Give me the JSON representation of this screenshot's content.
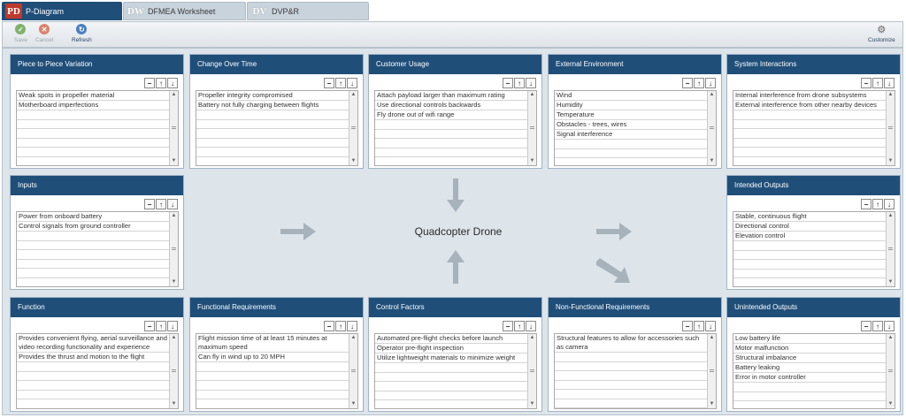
{
  "tabs": [
    {
      "abbr": "PD",
      "label": "P-Diagram"
    },
    {
      "abbr": "DW",
      "label": "DFMEA Worksheet"
    },
    {
      "abbr": "DV",
      "label": "DVP&R"
    }
  ],
  "toolbar": {
    "save": "Save",
    "cancel": "Cancel",
    "refresh": "Refresh",
    "customize": "Customize"
  },
  "center": {
    "title": "Quadcopter Drone"
  },
  "panel_buttons": {
    "remove": "−",
    "up": "↑",
    "down": "↓"
  },
  "panels": {
    "piece": {
      "title": "Piece to Piece Variation",
      "items": [
        "Weak spots in propeller material",
        "Motherboard imperfections"
      ]
    },
    "change": {
      "title": "Change Over Time",
      "items": [
        "Propeller integrity compromised",
        "Battery not fully charging between flights"
      ]
    },
    "customer": {
      "title": "Customer Usage",
      "items": [
        "Attach payload larger than maximum rating",
        "Use directional controls backwards",
        "Fly drone out of wifi range"
      ]
    },
    "external": {
      "title": "External Environment",
      "items": [
        "Wind",
        "Humidity",
        "Temperature",
        "Obstacles - trees, wires",
        "Signal interference"
      ]
    },
    "system": {
      "title": "System Interactions",
      "items": [
        "Internal interference from drone subsystems",
        "External interference from other nearby devices"
      ]
    },
    "inputs": {
      "title": "Inputs",
      "items": [
        "Power from onboard battery",
        "Control signals from ground controller"
      ]
    },
    "intended": {
      "title": "Intended Outputs",
      "items": [
        "Stable, continuous flight",
        "Directional control",
        "Elevation control"
      ]
    },
    "function": {
      "title": "Function",
      "items": [
        "Provides convenient flying, aerial surveillance and video recording functionality and experience",
        "Provides the thrust and motion to the flight"
      ]
    },
    "funcreq": {
      "title": "Functional Requirements",
      "items": [
        "Flight mission time of at least 15 minutes at maximum speed",
        "Can fly in wind up to 20 MPH"
      ]
    },
    "control": {
      "title": "Control Factors",
      "items": [
        "Automated pre-flight checks before launch",
        "Operator pre-flight inspection",
        "Utilize lightweight materials to minimize weight"
      ]
    },
    "nonfunc": {
      "title": "Non-Functional Requirements",
      "items": [
        "Structural features to allow for accessories such as camera"
      ]
    },
    "unintended": {
      "title": "Unintended Outputs",
      "items": [
        "Low battery life",
        "Motor malfunction",
        "Structural imbalance",
        "Battery leaking",
        "Error in motor controller"
      ]
    }
  },
  "colors": {
    "header": "#1f4e79",
    "active_tab_badge": "#c0392b",
    "canvas": "#dde4ea",
    "arrow": "#a8b2ba"
  },
  "icons": {
    "save": "check-circle-icon",
    "cancel": "x-circle-icon",
    "refresh": "refresh-icon",
    "customize": "gear-icon"
  }
}
